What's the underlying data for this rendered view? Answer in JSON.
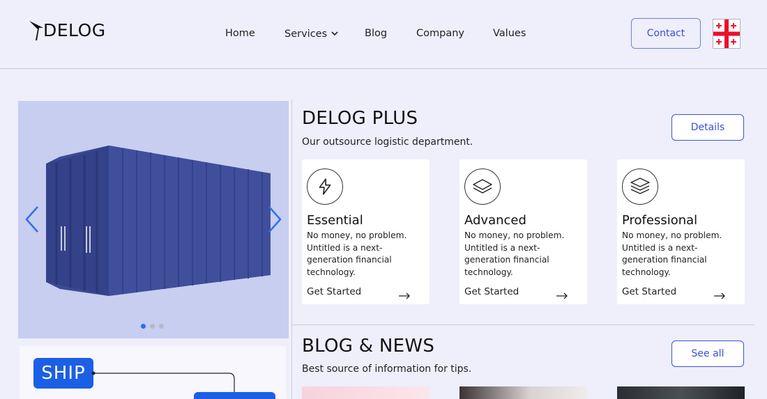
{
  "header": {
    "logo_text": "DELOG",
    "nav": [
      {
        "label": "Home"
      },
      {
        "label": "Services"
      },
      {
        "label": "Blog"
      },
      {
        "label": "Company"
      },
      {
        "label": "Values"
      }
    ],
    "contact_label": "Contact",
    "language_flag": "georgia-flag-icon"
  },
  "slider": {
    "slide_count": 3,
    "active_index": 0
  },
  "ship_card": {
    "badge_label": "SHIP"
  },
  "plus": {
    "title": "DELOG PLUS",
    "subtitle": "Our outsource logistic department.",
    "details_label": "Details",
    "cards": [
      {
        "icon": "lightning-icon",
        "title": "Essential",
        "description": "No money, no problem. Untitled is a next-generation financial technology.",
        "link_label": "Get Started"
      },
      {
        "icon": "layers-icon",
        "title": "Advanced",
        "description": "No money, no problem. Untitled is a next-generation financial technology.",
        "link_label": "Get Started"
      },
      {
        "icon": "stack-icon",
        "title": "Professional",
        "description": "No money, no problem. Untitled is a next-generation financial technology.",
        "link_label": "Get Started"
      }
    ]
  },
  "blog": {
    "title": "BLOG & NEWS",
    "subtitle": "Best source of information for tips.",
    "see_all_label": "See all"
  },
  "colors": {
    "background": "#efeefb",
    "accent": "#3b4fd6",
    "ship_blue": "#1b5fe4",
    "container_blue": "#3a4a94"
  }
}
